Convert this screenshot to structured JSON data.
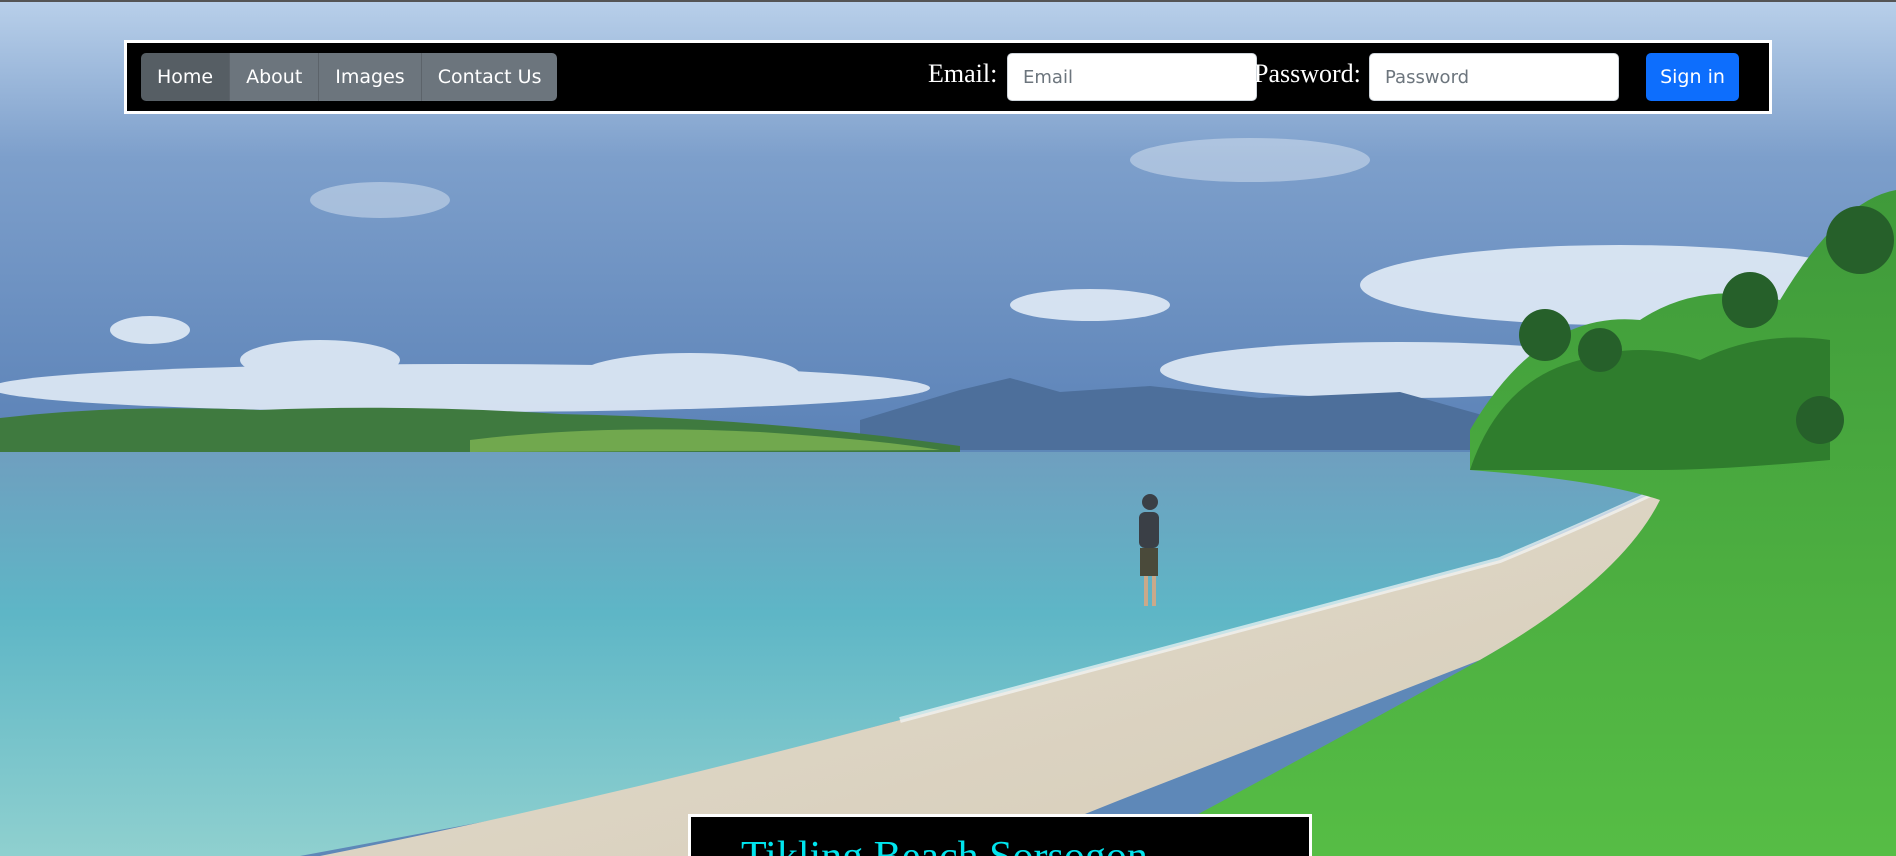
{
  "nav": {
    "items": [
      {
        "label": "Home",
        "active": true
      },
      {
        "label": "About",
        "active": false
      },
      {
        "label": "Images",
        "active": false
      },
      {
        "label": "Contact Us",
        "active": false
      }
    ]
  },
  "login": {
    "email_label": "Email:",
    "email_placeholder": "Email",
    "email_value": "",
    "password_label": "Password:",
    "password_placeholder": "Password",
    "password_value": "",
    "signin_label": "Sign in"
  },
  "caption": {
    "title": "Tikling Beach Sorsogon"
  },
  "colors": {
    "navbar_bg": "#000000",
    "nav_button": "#6c757d",
    "nav_button_active": "#565e64",
    "signin_button": "#0d6efd",
    "caption_text": "#00e5ee"
  }
}
